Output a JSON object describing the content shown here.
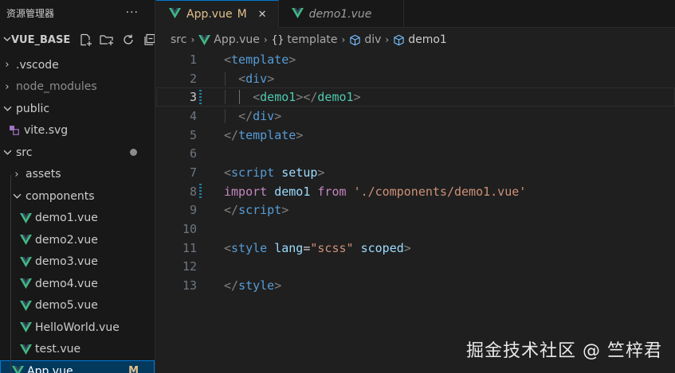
{
  "sidebar": {
    "title": "资源管理器",
    "more": "···",
    "root_label": "VUE_BASE",
    "items": [
      {
        "label": ".vscode",
        "type": "folder",
        "expanded": false
      },
      {
        "label": "node_modules",
        "type": "folder",
        "expanded": false
      },
      {
        "label": "public",
        "type": "folder",
        "expanded": true
      },
      {
        "label": "vite.svg",
        "type": "file-svg"
      },
      {
        "label": "src",
        "type": "folder",
        "expanded": true
      },
      {
        "label": "assets",
        "type": "folder",
        "expanded": false
      },
      {
        "label": "components",
        "type": "folder",
        "expanded": true
      },
      {
        "label": "demo1.vue",
        "type": "file-vue"
      },
      {
        "label": "demo2.vue",
        "type": "file-vue"
      },
      {
        "label": "demo3.vue",
        "type": "file-vue"
      },
      {
        "label": "demo4.vue",
        "type": "file-vue"
      },
      {
        "label": "demo5.vue",
        "type": "file-vue"
      },
      {
        "label": "HelloWorld.vue",
        "type": "file-vue"
      },
      {
        "label": "test.vue",
        "type": "file-vue"
      },
      {
        "label": "App.vue",
        "type": "file-vue",
        "badge": "M"
      }
    ]
  },
  "tabs": [
    {
      "label": "App.vue",
      "modified": "M",
      "close": "✕"
    },
    {
      "label": "demo1.vue"
    }
  ],
  "breadcrumb": {
    "items": [
      "src",
      "App.vue",
      "template",
      "div",
      "demo1"
    ],
    "brace": "{}"
  },
  "editor": {
    "line_numbers": [
      "1",
      "2",
      "3",
      "4",
      "5",
      "6",
      "7",
      "8",
      "9",
      "10",
      "11",
      "12",
      "13"
    ],
    "lines": [
      [
        {
          "t": "<",
          "c": "punc"
        },
        {
          "t": "template",
          "c": "tag"
        },
        {
          "t": ">",
          "c": "punc"
        }
      ],
      [
        {
          "t": "  ",
          "c": "plain"
        },
        {
          "t": "<",
          "c": "punc"
        },
        {
          "t": "div",
          "c": "tag"
        },
        {
          "t": ">",
          "c": "punc"
        }
      ],
      [
        {
          "t": "    ",
          "c": "plain"
        },
        {
          "t": "<",
          "c": "punc"
        },
        {
          "t": "demo1",
          "c": "comp"
        },
        {
          "t": "></",
          "c": "punc"
        },
        {
          "t": "demo1",
          "c": "comp"
        },
        {
          "t": ">",
          "c": "punc"
        }
      ],
      [
        {
          "t": "  ",
          "c": "plain"
        },
        {
          "t": "</",
          "c": "punc"
        },
        {
          "t": "div",
          "c": "tag"
        },
        {
          "t": ">",
          "c": "punc"
        }
      ],
      [
        {
          "t": "</",
          "c": "punc"
        },
        {
          "t": "template",
          "c": "tag"
        },
        {
          "t": ">",
          "c": "punc"
        }
      ],
      [],
      [
        {
          "t": "<",
          "c": "punc"
        },
        {
          "t": "script",
          "c": "tag"
        },
        {
          "t": " ",
          "c": "plain"
        },
        {
          "t": "setup",
          "c": "attr"
        },
        {
          "t": ">",
          "c": "punc"
        }
      ],
      [
        {
          "t": "import",
          "c": "kw"
        },
        {
          "t": " ",
          "c": "plain"
        },
        {
          "t": "demo1",
          "c": "var"
        },
        {
          "t": " ",
          "c": "plain"
        },
        {
          "t": "from",
          "c": "kw"
        },
        {
          "t": " ",
          "c": "plain"
        },
        {
          "t": "'./components/demo1.vue'",
          "c": "str"
        }
      ],
      [
        {
          "t": "</",
          "c": "punc"
        },
        {
          "t": "script",
          "c": "tag"
        },
        {
          "t": ">",
          "c": "punc"
        }
      ],
      [],
      [
        {
          "t": "<",
          "c": "punc"
        },
        {
          "t": "style",
          "c": "tag"
        },
        {
          "t": " ",
          "c": "plain"
        },
        {
          "t": "lang",
          "c": "attr"
        },
        {
          "t": "=",
          "c": "plain"
        },
        {
          "t": "\"scss\"",
          "c": "str"
        },
        {
          "t": " ",
          "c": "plain"
        },
        {
          "t": "scoped",
          "c": "attr"
        },
        {
          "t": ">",
          "c": "punc"
        }
      ],
      [],
      [
        {
          "t": "</",
          "c": "punc"
        },
        {
          "t": "style",
          "c": "tag"
        },
        {
          "t": ">",
          "c": "punc"
        }
      ]
    ],
    "current_line": 3,
    "modified_lines": [
      3,
      8
    ]
  },
  "watermark": "掘金技术社区 @ 竺梓君",
  "colors": {
    "accent": "#0078d4",
    "vue_green": "#41b883",
    "modified": "#e2c08d"
  }
}
